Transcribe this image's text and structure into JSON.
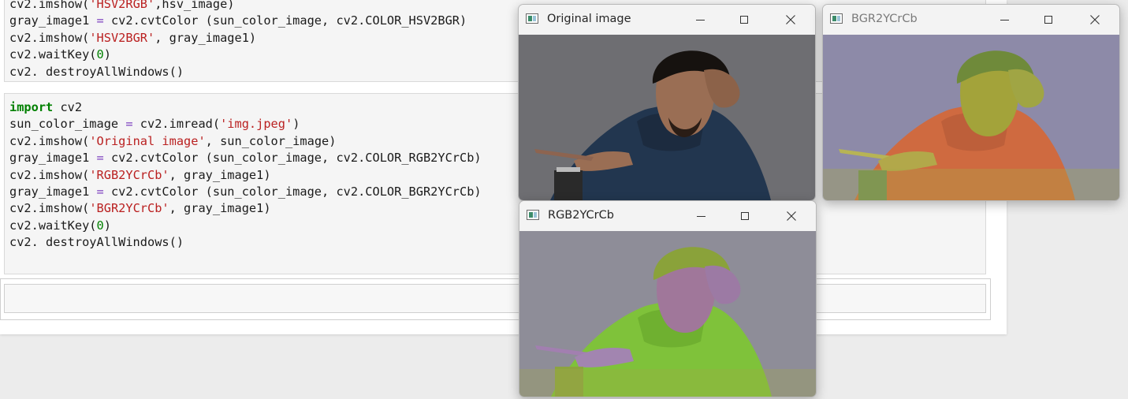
{
  "notebook": {
    "cell1_lines": [
      [
        {
          "t": "cv2.imshow(",
          "c": ""
        },
        {
          "t": "'HSV2RGB'",
          "c": "str"
        },
        {
          "t": ",hsv_image)",
          "c": ""
        }
      ],
      [
        {
          "t": "gray_image1 ",
          "c": ""
        },
        {
          "t": "=",
          "c": "op"
        },
        {
          "t": " cv2.cvtColor (sun_color_image, cv2.COLOR_HSV2BGR)",
          "c": ""
        }
      ],
      [
        {
          "t": "cv2.imshow(",
          "c": ""
        },
        {
          "t": "'HSV2BGR'",
          "c": "str"
        },
        {
          "t": ", gray_image1)",
          "c": ""
        }
      ],
      [
        {
          "t": "cv2.waitKey(",
          "c": ""
        },
        {
          "t": "0",
          "c": "num"
        },
        {
          "t": ")",
          "c": ""
        }
      ],
      [
        {
          "t": "cv2. destroyAllWindows()",
          "c": ""
        }
      ]
    ],
    "cell2_lines": [
      [
        {
          "t": "import",
          "c": "kw"
        },
        {
          "t": " cv2",
          "c": ""
        }
      ],
      [
        {
          "t": "sun_color_image ",
          "c": ""
        },
        {
          "t": "=",
          "c": "op"
        },
        {
          "t": " cv2.imread(",
          "c": ""
        },
        {
          "t": "'img.jpeg'",
          "c": "str"
        },
        {
          "t": ")",
          "c": ""
        }
      ],
      [
        {
          "t": "cv2.imshow(",
          "c": ""
        },
        {
          "t": "'Original image'",
          "c": "str"
        },
        {
          "t": ", sun_color_image)",
          "c": ""
        }
      ],
      [
        {
          "t": "gray_image1 ",
          "c": ""
        },
        {
          "t": "=",
          "c": "op"
        },
        {
          "t": " cv2.cvtColor (sun_color_image, cv2.COLOR_RGB2YCrCb)",
          "c": ""
        }
      ],
      [
        {
          "t": "cv2.imshow(",
          "c": ""
        },
        {
          "t": "'RGB2YCrCb'",
          "c": "str"
        },
        {
          "t": ", gray_image1)",
          "c": ""
        }
      ],
      [
        {
          "t": "gray_image1 ",
          "c": ""
        },
        {
          "t": "=",
          "c": "op"
        },
        {
          "t": " cv2.cvtColor (sun_color_image, cv2.COLOR_BGR2YCrCb)",
          "c": ""
        }
      ],
      [
        {
          "t": "cv2.imshow(",
          "c": ""
        },
        {
          "t": "'BGR2YCrCb'",
          "c": "str"
        },
        {
          "t": ", gray_image1)",
          "c": ""
        }
      ],
      [
        {
          "t": "cv2.waitKey(",
          "c": ""
        },
        {
          "t": "0",
          "c": "num"
        },
        {
          "t": ")",
          "c": ""
        }
      ],
      [
        {
          "t": "cv2. destroyAllWindows()",
          "c": ""
        }
      ]
    ]
  },
  "windows": {
    "original": {
      "title": "Original image"
    },
    "bgr": {
      "title": "BGR2YCrCb"
    },
    "rgb": {
      "title": "RGB2YCrCb"
    }
  },
  "icons": {
    "app": "opencv-window-icon",
    "minimize": "minimize-icon",
    "maximize": "maximize-icon",
    "close": "close-icon"
  },
  "colors": {
    "code_keyword": "#008000",
    "code_string": "#ba2121",
    "code_operator": "#7c3fbf",
    "cell_bg": "#f5f5f5"
  }
}
